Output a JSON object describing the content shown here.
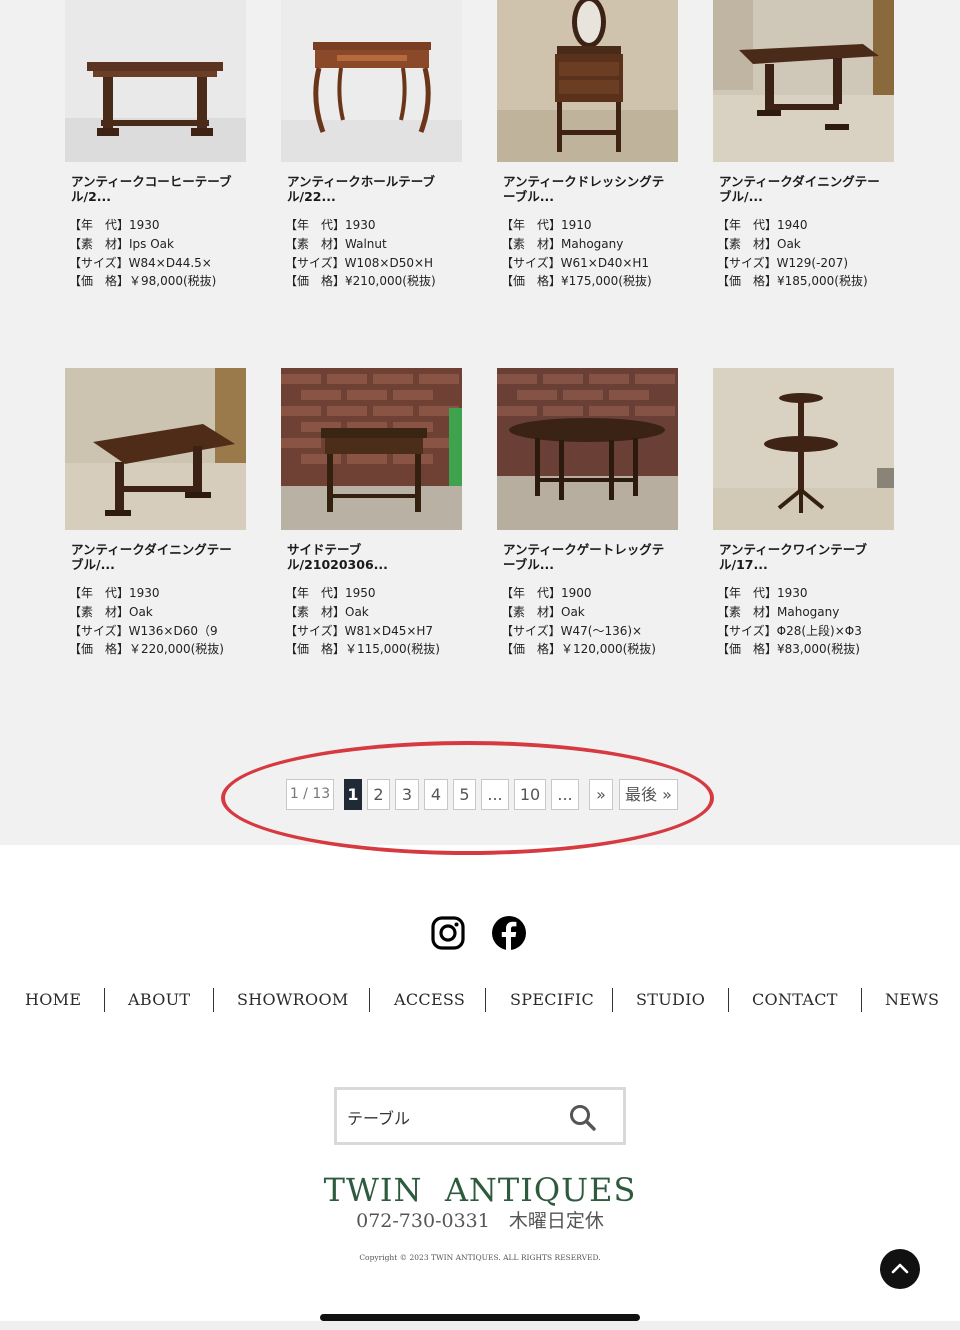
{
  "products": [
    {
      "title": "アンティークコーヒーテーブル/2...",
      "specs": [
        "【年　代】1930",
        "【素　材】Ips Oak",
        "【サイズ】W84×D44.5×",
        "【価　格】￥98,000(税抜)"
      ]
    },
    {
      "title": "アンティークホールテーブル/22...",
      "specs": [
        "【年　代】1930",
        "【素　材】Walnut",
        "【サイズ】W108×D50×H",
        "【価　格】¥210,000(税抜)"
      ]
    },
    {
      "title": "アンティークドレッシングテーブル...",
      "specs": [
        "【年　代】1910",
        "【素　材】Mahogany",
        "【サイズ】W61×D40×H1",
        "【価　格】¥175,000(税抜)"
      ]
    },
    {
      "title": "アンティークダイニングテーブル/...",
      "specs": [
        "【年　代】1940",
        "【素　材】Oak",
        "【サイズ】W129(-207)",
        "【価　格】¥185,000(税抜)"
      ]
    },
    {
      "title": "アンティークダイニングテーブル/...",
      "specs": [
        "【年　代】1930",
        "【素　材】Oak",
        "【サイズ】W136×D60（9",
        "【価　格】￥220,000(税抜)"
      ]
    },
    {
      "title": "サイドテーブル/21020306...",
      "specs": [
        "【年　代】1950",
        "【素　材】Oak",
        "【サイズ】W81×D45×H7",
        "【価　格】￥115,000(税抜)"
      ]
    },
    {
      "title": "アンティークゲートレッグテーブル...",
      "specs": [
        "【年　代】1900",
        "【素　材】Oak",
        "【サイズ】W47(〜136)×",
        "【価　格】￥120,000(税抜)"
      ]
    },
    {
      "title": "アンティークワインテーブル/17...",
      "specs": [
        "【年　代】1930",
        "【素　材】Mahogany",
        "【サイズ】Φ28(上段)×Φ3",
        "【価　格】¥83,000(税抜)"
      ]
    }
  ],
  "pagination": {
    "info": "1 / 13",
    "pages": [
      "1",
      "2",
      "3",
      "4",
      "5",
      "...",
      "10",
      "..."
    ],
    "current": "1",
    "next": "»",
    "last": "最後 »"
  },
  "social": {
    "icons": [
      "instagram-icon",
      "facebook-icon"
    ]
  },
  "footer_nav": [
    "HOME",
    "ABOUT",
    "SHOWROOM",
    "ACCESS",
    "SPECIFIC",
    "STUDIO",
    "CONTACT",
    "NEWS"
  ],
  "search": {
    "value": "テーブル",
    "icon": "search-icon"
  },
  "brand": {
    "name": "TWIN  ANTIQUES",
    "phone": "072-730-0331　木曜日定休",
    "copyright": "Copyright © 2023 TWIN ANTIQUES. ALL RIGHTS RESERVED."
  },
  "colors": {
    "brand_green": "#2e5a3e",
    "page_active": "#1f2a35",
    "annotation_red": "#d6393f"
  }
}
